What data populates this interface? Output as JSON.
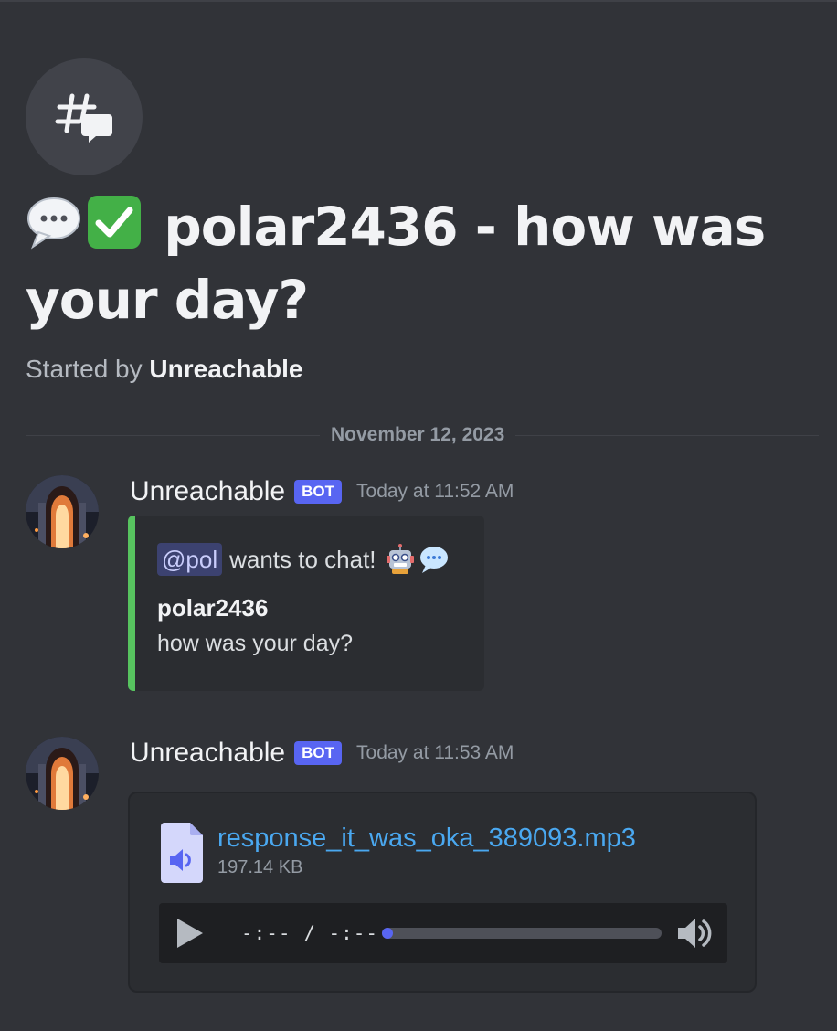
{
  "thread": {
    "title_text": "polar2436 - how was your day?",
    "title_emojis": [
      "speech-balloon",
      "check-mark"
    ],
    "started_by_prefix": "Started by",
    "started_by_user": "Unreachable"
  },
  "divider_date": "November 12, 2023",
  "messages": [
    {
      "username": "Unreachable",
      "badge": "BOT",
      "timestamp": "Today at 11:52 AM",
      "embed": {
        "accent_color": "#57c35f",
        "mention": "@pol",
        "text": "wants to chat!",
        "emojis": [
          "robot",
          "speech-balloon"
        ],
        "name": "polar2436",
        "description": "how was your day?"
      }
    },
    {
      "username": "Unreachable",
      "badge": "BOT",
      "timestamp": "Today at 11:53 AM",
      "attachment": {
        "file_name": "response_it_was_oka_389093.mp3",
        "file_size": "197.14 KB",
        "time_display": "-:-- / -:--",
        "progress": 0
      }
    }
  ],
  "colors": {
    "background": "#313338",
    "brand": "#5865f2",
    "link": "#4aa8f0"
  }
}
